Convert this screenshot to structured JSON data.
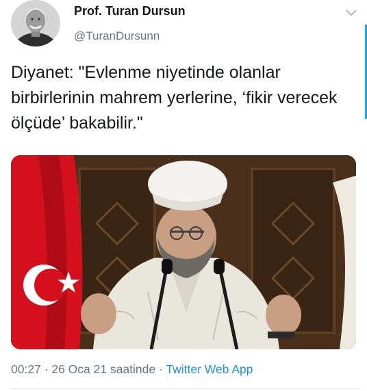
{
  "author": {
    "name": "Prof. Turan Dursun",
    "handle": "@TuranDursunn"
  },
  "tweet": {
    "text": "Diyanet: \"Evlenme niyetinde olanlar birbirlerinin mahrem yerlerine, ‘fikir verecek ölçüde’ bakabilir.\""
  },
  "meta": {
    "time": "00:27",
    "separator": " · ",
    "date": "26 Oca 21 saatinde",
    "source": "Twitter Web App"
  },
  "icons": {
    "menu": "chevron-down-icon"
  },
  "colors": {
    "text": "#14171a",
    "secondary": "#657786",
    "link": "#1b95e0",
    "accent": "#1da1f2"
  }
}
